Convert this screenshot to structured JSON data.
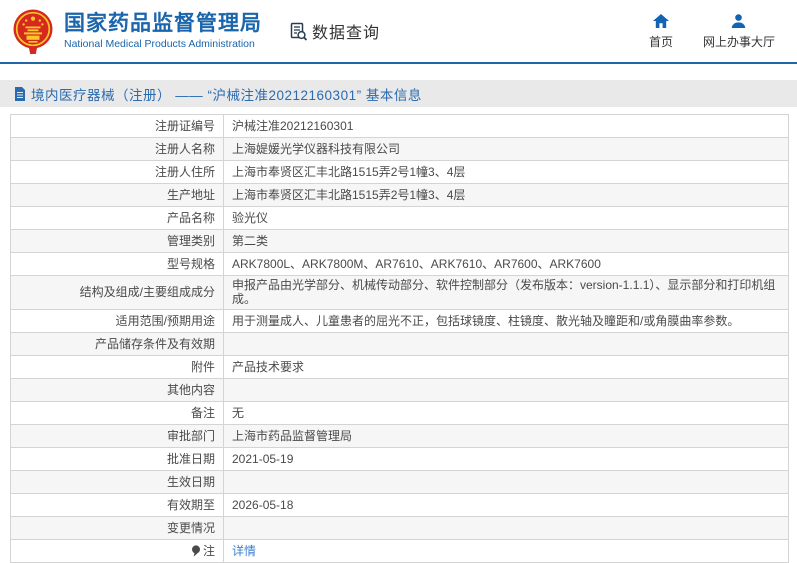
{
  "header": {
    "org_name_cn": "国家药品监督管理局",
    "org_name_en": "National Medical Products Administration",
    "nav_data_query": "数据查询",
    "nav_home": "首页",
    "nav_service_hall": "网上办事大厅"
  },
  "breadcrumb": {
    "text": "境内医疗器械（注册） —— “沪械注准20212160301” 基本信息"
  },
  "table": {
    "rows": [
      {
        "label": "注册证编号",
        "value": "沪械注准20212160301"
      },
      {
        "label": "注册人名称",
        "value": "上海媞媛光学仪器科技有限公司"
      },
      {
        "label": "注册人住所",
        "value": "上海市奉贤区汇丰北路1515弄2号1幢3、4层"
      },
      {
        "label": "生产地址",
        "value": "上海市奉贤区汇丰北路1515弄2号1幢3、4层"
      },
      {
        "label": "产品名称",
        "value": "验光仪"
      },
      {
        "label": "管理类别",
        "value": "第二类"
      },
      {
        "label": "型号规格",
        "value": "ARK7800L、ARK7800M、AR7610、ARK7610、AR7600、ARK7600"
      },
      {
        "label": "结构及组成/主要组成成分",
        "value": "申报产品由光学部分、机械传动部分、软件控制部分（发布版本：version-1.1.1）、显示部分和打印机组成。"
      },
      {
        "label": "适用范围/预期用途",
        "value": "用于测量成人、儿童患者的屈光不正，包括球镜度、柱镜度、散光轴及瞳距和/或角膜曲率参数。"
      },
      {
        "label": "产品储存条件及有效期",
        "value": ""
      },
      {
        "label": "附件",
        "value": "产品技术要求"
      },
      {
        "label": "其他内容",
        "value": ""
      },
      {
        "label": "备注",
        "value": "无"
      },
      {
        "label": "审批部门",
        "value": "上海市药品监督管理局"
      },
      {
        "label": "批准日期",
        "value": "2021-05-19"
      },
      {
        "label": "生效日期",
        "value": ""
      },
      {
        "label": "有效期至",
        "value": "2026-05-18"
      },
      {
        "label": "变更情况",
        "value": ""
      },
      {
        "label": "注",
        "value": "详情",
        "link": true,
        "icon": "note-icon"
      }
    ]
  },
  "colors": {
    "brand_blue": "#1a65ab",
    "icon_blue": "#1464b4",
    "accent_line": "#2166a5",
    "breadcrumb_bg": "#e9e9e9",
    "breadcrumb_text": "#2a6bb0",
    "link_blue": "#3e7fd0",
    "row_alt_bg": "#f6f6f6",
    "table_border": "#d4d4d4",
    "emblem_red": "#d6281e",
    "emblem_gold": "#f7c928"
  }
}
